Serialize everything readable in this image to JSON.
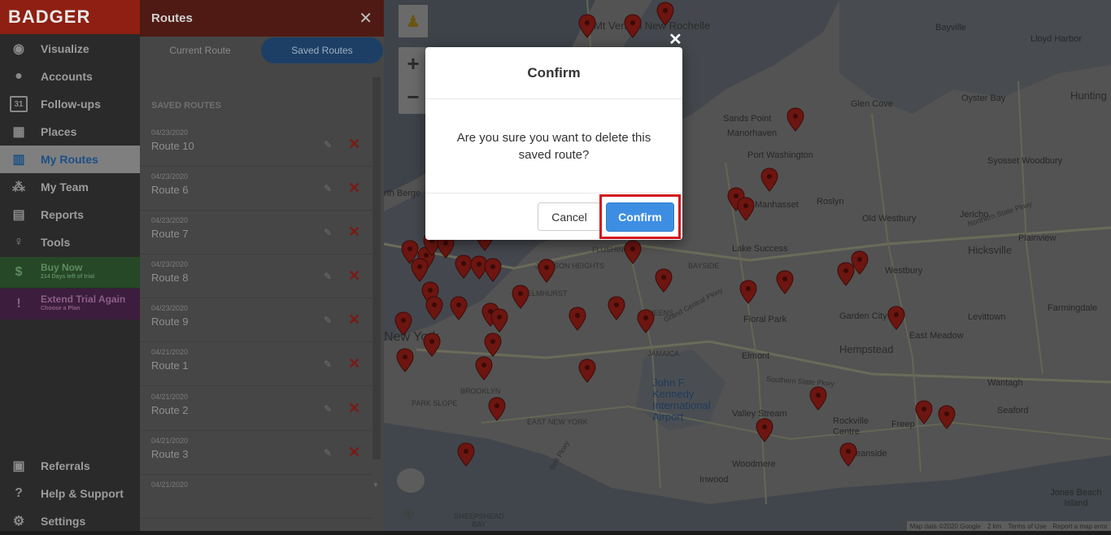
{
  "app": {
    "logo": "BADGER"
  },
  "nav": {
    "items": [
      {
        "label": "Visualize",
        "icon": "eye-icon"
      },
      {
        "label": "Accounts",
        "icon": "person-icon"
      },
      {
        "label": "Follow-ups",
        "icon": "calendar-icon",
        "badge": "31"
      },
      {
        "label": "Places",
        "icon": "store-icon"
      },
      {
        "label": "My Routes",
        "icon": "map-icon",
        "active": true
      },
      {
        "label": "My Team",
        "icon": "team-icon"
      },
      {
        "label": "Reports",
        "icon": "chart-icon"
      },
      {
        "label": "Tools",
        "icon": "tools-icon"
      }
    ],
    "buy_now": {
      "label": "Buy Now",
      "sub": "214 Days left of trial",
      "color": "#2a7a2a"
    },
    "extend": {
      "label": "Extend Trial Again",
      "sub": "Choose a Plan",
      "color": "#6a1a6a"
    },
    "bottom": [
      {
        "label": "Referrals",
        "icon": "gift-icon"
      },
      {
        "label": "Help & Support",
        "icon": "help-icon"
      },
      {
        "label": "Settings",
        "icon": "gear-icon"
      }
    ]
  },
  "panel": {
    "title": "Routes",
    "tabs": {
      "current": "Current Route",
      "saved": "Saved Routes"
    },
    "saved_heading": "SAVED ROUTES",
    "routes": [
      {
        "date": "04/23/2020",
        "name": "Route 10"
      },
      {
        "date": "04/23/2020",
        "name": "Route 6"
      },
      {
        "date": "04/23/2020",
        "name": "Route 7"
      },
      {
        "date": "04/23/2020",
        "name": "Route 8"
      },
      {
        "date": "04/23/2020",
        "name": "Route 9"
      },
      {
        "date": "04/21/2020",
        "name": "Route 1"
      },
      {
        "date": "04/21/2020",
        "name": "Route 2"
      },
      {
        "date": "04/21/2020",
        "name": "Route 3"
      },
      {
        "date": "04/21/2020",
        "name": ""
      }
    ]
  },
  "map": {
    "labels": {
      "mt_vernon": "Mt Vernon New Rochelle",
      "bayville": "Bayville",
      "lloyd_harbor": "Lloyd Harbor",
      "glen_cove": "Glen Cove",
      "oyster_bay": "Oyster Bay",
      "huntington": "Hunting",
      "sands_point": "Sands Point",
      "manorhaven": "Manorhaven",
      "port_washington": "Port Washington",
      "syosset": "Syosset Woodbury",
      "manhasset": "Manhasset",
      "roslyn": "Roslyn",
      "jericho": "Jericho",
      "old_westbury": "Old Westbury",
      "plainview": "Plainview",
      "north_bergen": "rth Berge",
      "lake_success": "Lake Success",
      "hicksville": "Hicksville",
      "jackson_heights": "JACKSON HEIGHTS",
      "flushing": "FLUSHING",
      "bayside": "BAYSIDE",
      "elmhurst": "ELMHURST",
      "queens": "QUEENS",
      "westbury": "Westbury",
      "floral_park": "Floral Park",
      "garden_city": "Garden City",
      "levittown": "Levittown",
      "farmingdale": "Farmingdale",
      "east_meadow": "East Meadow",
      "new_york": "New York",
      "jamaica": "JAMAICA",
      "elmont": "Elmont",
      "hempstead": "Hempstead",
      "brooklyn": "BROOKLYN",
      "jfk": "John F. Kennedy International Airport",
      "wantagh": "Wantagh",
      "park_slope": "PARK SLOPE",
      "east_new_york": "EAST NEW YORK",
      "valley_stream": "Valley Stream",
      "rockville": "Rockville Centre",
      "freeport": "Freep",
      "seaford": "Seaford",
      "woodmere": "Woodmere",
      "oceanside": "Oceanside",
      "inwood": "Inwood",
      "jones_beach": "Jones Beach Island",
      "sheepshead": "SHEEPSHEAD BAY",
      "southern_state": "Southern State Pkwy",
      "northern_state": "Northern State Pkwy",
      "grand_central": "Grand Central Pkwy",
      "belt_pkwy": "Belt Pkwy"
    },
    "attribution": [
      "Map data ©2020 Google",
      "2 km",
      "Terms of Use",
      "Report a map error"
    ]
  },
  "modal": {
    "title": "Confirm",
    "message": "Are you sure you want to delete this saved route?",
    "cancel": "Cancel",
    "confirm": "Confirm",
    "close_glyph": "✕"
  }
}
